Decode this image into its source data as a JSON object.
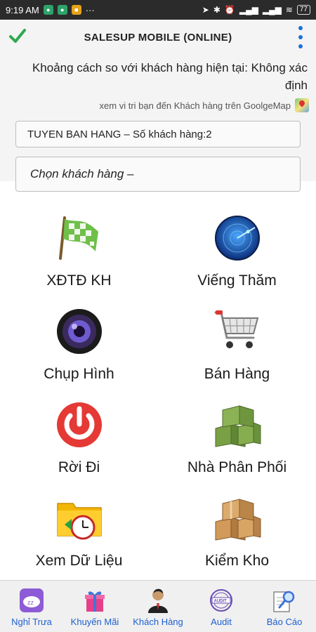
{
  "status_bar": {
    "time": "9:19 AM",
    "dots": "···",
    "battery": "77"
  },
  "app_bar": {
    "title": "SALESUP MOBILE (ONLINE)"
  },
  "distance_text": "Khoảng cách so với khách hàng hiện tại: Không xác định",
  "map_link_text": "xem vi tri bạn đến Khách hàng trên GoolgeMap",
  "route_field": "TUYEN BAN HANG – Số khách hàng:2",
  "customer_field": "Chọn khách hàng –",
  "tiles": [
    {
      "label": "XĐTĐ KH",
      "icon": "checkered-flag-icon"
    },
    {
      "label": "Viếng Thăm",
      "icon": "radar-icon"
    },
    {
      "label": "Chụp Hình",
      "icon": "camera-lens-icon"
    },
    {
      "label": "Bán Hàng",
      "icon": "shopping-cart-icon"
    },
    {
      "label": "Rời Đi",
      "icon": "power-icon"
    },
    {
      "label": "Nhà Phân Phối",
      "icon": "green-boxes-icon"
    },
    {
      "label": "Xem Dữ Liệu",
      "icon": "folder-clock-icon"
    },
    {
      "label": "Kiểm Kho",
      "icon": "cardboard-boxes-icon"
    }
  ],
  "bottom_nav": [
    {
      "label": "Nghỉ Trưa",
      "icon": "sleep-icon"
    },
    {
      "label": "Khuyến Mãi",
      "icon": "gift-icon"
    },
    {
      "label": "Khách Hàng",
      "icon": "person-icon"
    },
    {
      "label": "Audit",
      "icon": "audit-stamp-icon"
    },
    {
      "label": "Báo Cáo",
      "icon": "report-magnifier-icon"
    }
  ],
  "colors": {
    "accent_blue": "#1e6fd9",
    "check_green": "#2fa84f",
    "nav_label_blue": "#1e5fd0"
  }
}
